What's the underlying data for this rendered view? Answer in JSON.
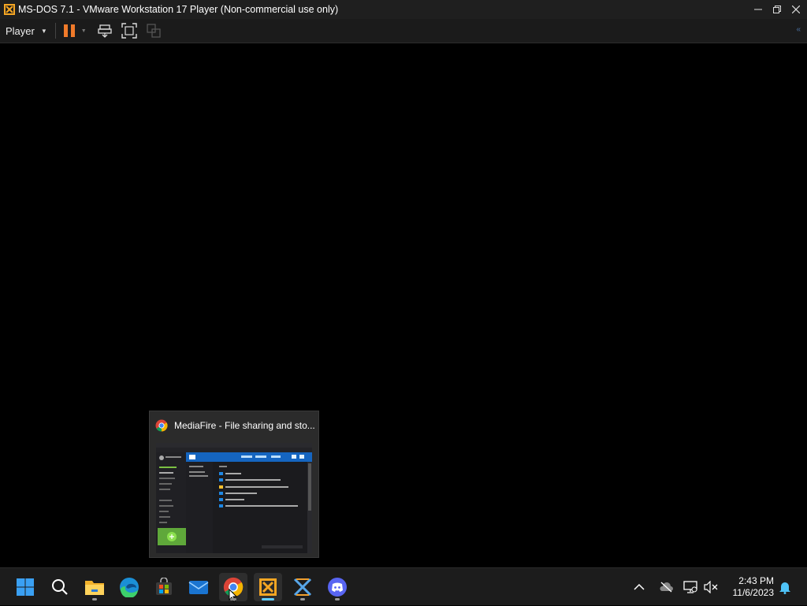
{
  "window": {
    "title": "MS-DOS 7.1 - VMware Workstation 17 Player (Non-commercial use only)",
    "icon": "vmware-player-icon",
    "controls": [
      "minimize-icon",
      "restore-icon",
      "close-icon"
    ]
  },
  "toolbar": {
    "player_label": "Player",
    "buttons": [
      "pause-icon",
      "send-ctrl-alt-del-icon",
      "fullscreen-icon",
      "unity-icon"
    ],
    "accent": "#f07a2a"
  },
  "preview": {
    "title": "MediaFire - File sharing and sto..."
  },
  "taskbar": {
    "apps": [
      "windows-start-icon",
      "search-icon",
      "file-explorer-icon",
      "edge-icon",
      "microsoft-store-icon",
      "mail-icon",
      "chrome-icon",
      "vmware-player-icon",
      "xming-icon",
      "discord-icon"
    ],
    "active_app": "chrome-icon"
  },
  "tray": {
    "time": "2:43 PM",
    "date": "11/6/2023"
  },
  "colors": {
    "accent_blue": "#60cdff",
    "taskbar_bg": "#1c1c1c"
  }
}
